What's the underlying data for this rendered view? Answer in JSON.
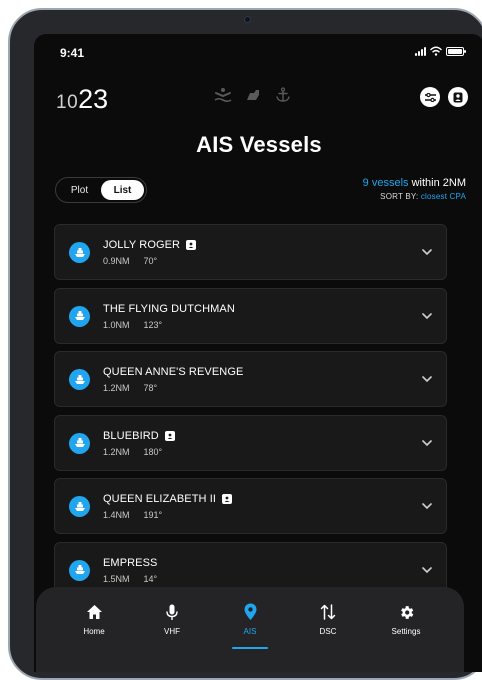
{
  "status": {
    "time": "9:41"
  },
  "header": {
    "clock_hours": "10",
    "clock_minutes": "23"
  },
  "page_title": "AIS Vessels",
  "view_toggle": {
    "options": [
      "Plot",
      "List"
    ],
    "selected": "List"
  },
  "summary": {
    "count_link": "9 vessels",
    "count_suffix": " within 2NM",
    "sort_prefix": "SORT BY: ",
    "sort_value": "closest CPA"
  },
  "vessels": [
    {
      "name": "JOLLY ROGER",
      "distance": "0.9NM",
      "bearing": "70°",
      "contact": true
    },
    {
      "name": "THE FLYING DUTCHMAN",
      "distance": "1.0NM",
      "bearing": "123°",
      "contact": false
    },
    {
      "name": "QUEEN ANNE'S REVENGE",
      "distance": "1.2NM",
      "bearing": "78°",
      "contact": false
    },
    {
      "name": "BLUEBIRD",
      "distance": "1.2NM",
      "bearing": "180°",
      "contact": true
    },
    {
      "name": "QUEEN ELIZABETH II",
      "distance": "1.4NM",
      "bearing": "191°",
      "contact": true
    },
    {
      "name": "EMPRESS",
      "distance": "1.5NM",
      "bearing": "14°",
      "contact": false
    }
  ],
  "nav": {
    "items": [
      {
        "label": "Home",
        "icon": "home-icon"
      },
      {
        "label": "VHF",
        "icon": "microphone-icon"
      },
      {
        "label": "AIS",
        "icon": "location-pin-icon"
      },
      {
        "label": "DSC",
        "icon": "swap-arrows-icon"
      },
      {
        "label": "Settings",
        "icon": "gear-icon"
      }
    ],
    "active": "AIS"
  },
  "colors": {
    "accent": "#21a5ef",
    "background": "#0b0b0b",
    "card": "#191919",
    "nav_background": "#242427",
    "dim_icon": "#5a5a5a"
  }
}
